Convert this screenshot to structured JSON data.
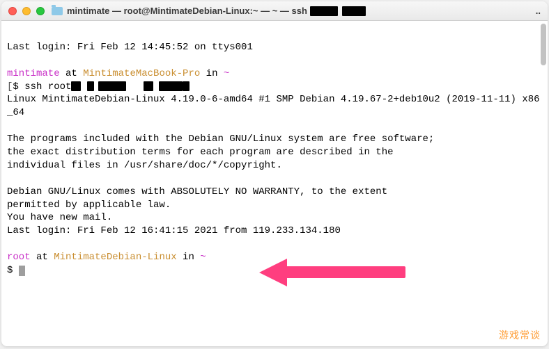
{
  "titlebar": {
    "title": "mintimate — root@MintimateDebian-Linux:~ — ~ — ssh",
    "trailing": ".."
  },
  "term": {
    "last_login_local": "Last login: Fri Feb 12 14:45:52 on ttys001",
    "local_user": "mintimate",
    "local_at": " at ",
    "local_host": "MintimateMacBook-Pro",
    "local_in": " in ",
    "local_path": "~",
    "prompt1_open": "[",
    "prompt1_dollar": "$ ",
    "ssh_cmd": "ssh root",
    "motd": "Linux MintimateDebian-Linux 4.19.0-6-amd64 #1 SMP Debian 4.19.67-2+deb10u2 (2019-11-11) x86_64",
    "blank1": "",
    "copy1": "The programs included with the Debian GNU/Linux system are free software;",
    "copy2": "the exact distribution terms for each program are described in the",
    "copy3": "individual files in /usr/share/doc/*/copyright.",
    "blank2": "",
    "warr1": "Debian GNU/Linux comes with ABSOLUTELY NO WARRANTY, to the extent",
    "warr2": "permitted by applicable law.",
    "mail": "You have new mail.",
    "last_login_remote": "Last login: Fri Feb 12 16:41:15 2021 from 119.233.134.180",
    "blank3": "",
    "remote_user": "root",
    "remote_at": " at ",
    "remote_host": "MintimateDebian-Linux",
    "remote_in": " in ",
    "remote_path": "~",
    "prompt2_dollar": "$ "
  },
  "watermark": "游戏常谈"
}
